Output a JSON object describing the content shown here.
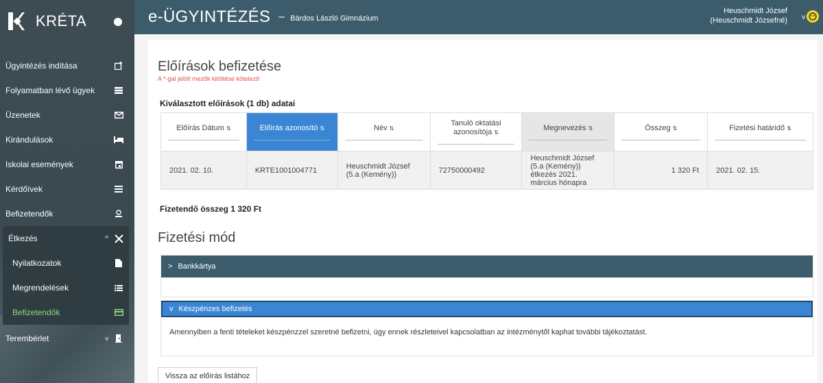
{
  "app": {
    "name": "KRÉTA"
  },
  "header": {
    "title": "e-ÜGYINTÉZÉS",
    "separator": "–",
    "school": "Bárdos László Gimnázium",
    "user_line1": "Heuschmidt József",
    "user_line2": "(Heuschmidt Józsefné)"
  },
  "sidebar": {
    "items": [
      {
        "label": "Ügyintézés indítása",
        "icon": "new-request-icon"
      },
      {
        "label": "Folyamatban lévő ügyek",
        "icon": "list-icon"
      },
      {
        "label": "Üzenetek",
        "icon": "envelope-icon"
      },
      {
        "label": "Kirándulások",
        "icon": "bed-icon"
      },
      {
        "label": "Iskolai események",
        "icon": "calendar-icon"
      },
      {
        "label": "Kérdőívek",
        "icon": "list-icon"
      },
      {
        "label": "Befizetendők",
        "icon": "money-icon"
      }
    ],
    "group": {
      "label": "Étkezés",
      "icon": "utensils-icon",
      "items": [
        {
          "label": "Nyilatkozatok",
          "icon": "document-icon"
        },
        {
          "label": "Megrendelések",
          "icon": "list-icon"
        },
        {
          "label": "Befizetendők",
          "icon": "credit-card-icon"
        }
      ]
    },
    "last": {
      "label": "Terembérlet",
      "icon": "door-icon"
    }
  },
  "page": {
    "title": "Előírások befizetése",
    "required_note": "A *-gal jelölt mezők kitöltése kötelező",
    "selected_title": "Kiválasztott előírások (1 db) adatai"
  },
  "table": {
    "columns": [
      {
        "label": "Előírás Dátum",
        "sort": "⇅"
      },
      {
        "label": "Előírás azonosító",
        "sort": "⇅"
      },
      {
        "label": "Név",
        "sort": "⇅"
      },
      {
        "label": "Tanuló oktatási azonosítója",
        "sort": "⇅"
      },
      {
        "label": "Megnevezés",
        "sort": "⇅"
      },
      {
        "label": "Összeg",
        "sort": "⇅"
      },
      {
        "label": "Fizetési határidő",
        "sort": "⇅"
      }
    ],
    "rows": [
      {
        "date": "2021. 02. 10.",
        "id": "KRTE1001004771",
        "name": "Heuschmidt József (5.a (Kemény))",
        "edu_id": "72750000492",
        "description": "Heuschmidt József (5.a (Kemény)) étkezés 2021. március hónapra",
        "amount": "1 320 Ft",
        "deadline": "2021. 02. 15."
      }
    ]
  },
  "total": "Fizetendő összeg 1 320 Ft",
  "payment": {
    "title": "Fizetési mód",
    "card_label": "Bankkártya",
    "cash_label": "Készpénzes befizetés",
    "cash_text": "Amennyiben a fenti tételeket készpénzzel szeretné befizetni, úgy ennek részleteivel kapcsolatban az intézménytől kaphat további tájékoztatást."
  },
  "back_button": "Vissza az előírás listához",
  "colors": {
    "header": "#3c5c6c",
    "accent": "#3b86d4",
    "active_nav": "#8ed67a"
  }
}
